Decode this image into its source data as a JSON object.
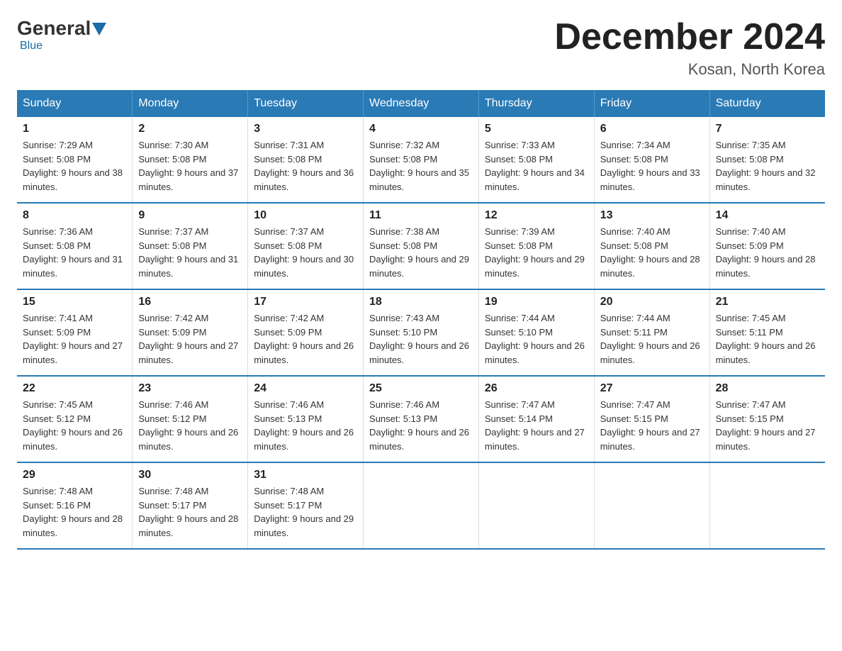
{
  "logo": {
    "general": "General",
    "blue": "Blue"
  },
  "header": {
    "title": "December 2024",
    "location": "Kosan, North Korea"
  },
  "days_of_week": [
    "Sunday",
    "Monday",
    "Tuesday",
    "Wednesday",
    "Thursday",
    "Friday",
    "Saturday"
  ],
  "weeks": [
    [
      {
        "day": "1",
        "sunrise": "7:29 AM",
        "sunset": "5:08 PM",
        "daylight": "9 hours and 38 minutes."
      },
      {
        "day": "2",
        "sunrise": "7:30 AM",
        "sunset": "5:08 PM",
        "daylight": "9 hours and 37 minutes."
      },
      {
        "day": "3",
        "sunrise": "7:31 AM",
        "sunset": "5:08 PM",
        "daylight": "9 hours and 36 minutes."
      },
      {
        "day": "4",
        "sunrise": "7:32 AM",
        "sunset": "5:08 PM",
        "daylight": "9 hours and 35 minutes."
      },
      {
        "day": "5",
        "sunrise": "7:33 AM",
        "sunset": "5:08 PM",
        "daylight": "9 hours and 34 minutes."
      },
      {
        "day": "6",
        "sunrise": "7:34 AM",
        "sunset": "5:08 PM",
        "daylight": "9 hours and 33 minutes."
      },
      {
        "day": "7",
        "sunrise": "7:35 AM",
        "sunset": "5:08 PM",
        "daylight": "9 hours and 32 minutes."
      }
    ],
    [
      {
        "day": "8",
        "sunrise": "7:36 AM",
        "sunset": "5:08 PM",
        "daylight": "9 hours and 31 minutes."
      },
      {
        "day": "9",
        "sunrise": "7:37 AM",
        "sunset": "5:08 PM",
        "daylight": "9 hours and 31 minutes."
      },
      {
        "day": "10",
        "sunrise": "7:37 AM",
        "sunset": "5:08 PM",
        "daylight": "9 hours and 30 minutes."
      },
      {
        "day": "11",
        "sunrise": "7:38 AM",
        "sunset": "5:08 PM",
        "daylight": "9 hours and 29 minutes."
      },
      {
        "day": "12",
        "sunrise": "7:39 AM",
        "sunset": "5:08 PM",
        "daylight": "9 hours and 29 minutes."
      },
      {
        "day": "13",
        "sunrise": "7:40 AM",
        "sunset": "5:08 PM",
        "daylight": "9 hours and 28 minutes."
      },
      {
        "day": "14",
        "sunrise": "7:40 AM",
        "sunset": "5:09 PM",
        "daylight": "9 hours and 28 minutes."
      }
    ],
    [
      {
        "day": "15",
        "sunrise": "7:41 AM",
        "sunset": "5:09 PM",
        "daylight": "9 hours and 27 minutes."
      },
      {
        "day": "16",
        "sunrise": "7:42 AM",
        "sunset": "5:09 PM",
        "daylight": "9 hours and 27 minutes."
      },
      {
        "day": "17",
        "sunrise": "7:42 AM",
        "sunset": "5:09 PM",
        "daylight": "9 hours and 26 minutes."
      },
      {
        "day": "18",
        "sunrise": "7:43 AM",
        "sunset": "5:10 PM",
        "daylight": "9 hours and 26 minutes."
      },
      {
        "day": "19",
        "sunrise": "7:44 AM",
        "sunset": "5:10 PM",
        "daylight": "9 hours and 26 minutes."
      },
      {
        "day": "20",
        "sunrise": "7:44 AM",
        "sunset": "5:11 PM",
        "daylight": "9 hours and 26 minutes."
      },
      {
        "day": "21",
        "sunrise": "7:45 AM",
        "sunset": "5:11 PM",
        "daylight": "9 hours and 26 minutes."
      }
    ],
    [
      {
        "day": "22",
        "sunrise": "7:45 AM",
        "sunset": "5:12 PM",
        "daylight": "9 hours and 26 minutes."
      },
      {
        "day": "23",
        "sunrise": "7:46 AM",
        "sunset": "5:12 PM",
        "daylight": "9 hours and 26 minutes."
      },
      {
        "day": "24",
        "sunrise": "7:46 AM",
        "sunset": "5:13 PM",
        "daylight": "9 hours and 26 minutes."
      },
      {
        "day": "25",
        "sunrise": "7:46 AM",
        "sunset": "5:13 PM",
        "daylight": "9 hours and 26 minutes."
      },
      {
        "day": "26",
        "sunrise": "7:47 AM",
        "sunset": "5:14 PM",
        "daylight": "9 hours and 27 minutes."
      },
      {
        "day": "27",
        "sunrise": "7:47 AM",
        "sunset": "5:15 PM",
        "daylight": "9 hours and 27 minutes."
      },
      {
        "day": "28",
        "sunrise": "7:47 AM",
        "sunset": "5:15 PM",
        "daylight": "9 hours and 27 minutes."
      }
    ],
    [
      {
        "day": "29",
        "sunrise": "7:48 AM",
        "sunset": "5:16 PM",
        "daylight": "9 hours and 28 minutes."
      },
      {
        "day": "30",
        "sunrise": "7:48 AM",
        "sunset": "5:17 PM",
        "daylight": "9 hours and 28 minutes."
      },
      {
        "day": "31",
        "sunrise": "7:48 AM",
        "sunset": "5:17 PM",
        "daylight": "9 hours and 29 minutes."
      },
      null,
      null,
      null,
      null
    ]
  ],
  "labels": {
    "sunrise": "Sunrise:",
    "sunset": "Sunset:",
    "daylight": "Daylight:"
  }
}
